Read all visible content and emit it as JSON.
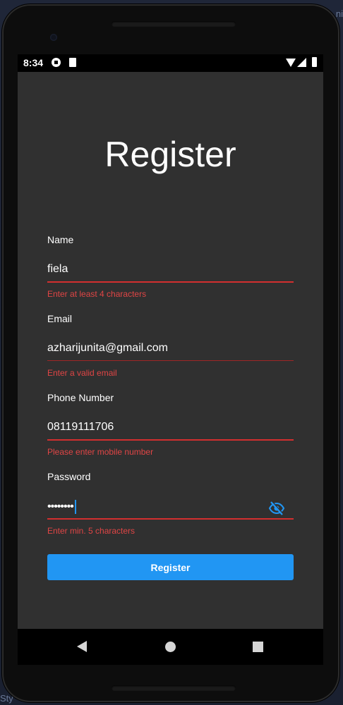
{
  "ide": {
    "right_fragment": "ni",
    "bottom_fragment": "Sty"
  },
  "status_bar": {
    "time": "8:34"
  },
  "screen": {
    "title": "Register"
  },
  "form": {
    "name": {
      "label": "Name",
      "value": "fiela",
      "error": "Enter at least 4 characters"
    },
    "email": {
      "label": "Email",
      "value": "azharijunita@gmail.com",
      "error": "Enter a valid email"
    },
    "phone": {
      "label": "Phone Number",
      "value": "08119111706",
      "error": "Please enter mobile number"
    },
    "password": {
      "label": "Password",
      "value": "••••••••",
      "error": "Enter min. 5 characters"
    },
    "submit_label": "Register"
  },
  "colors": {
    "background": "#303030",
    "accent": "#2196f3",
    "error": "#e04545"
  },
  "icons": {
    "visibility_toggle": "visibility-off-icon"
  }
}
